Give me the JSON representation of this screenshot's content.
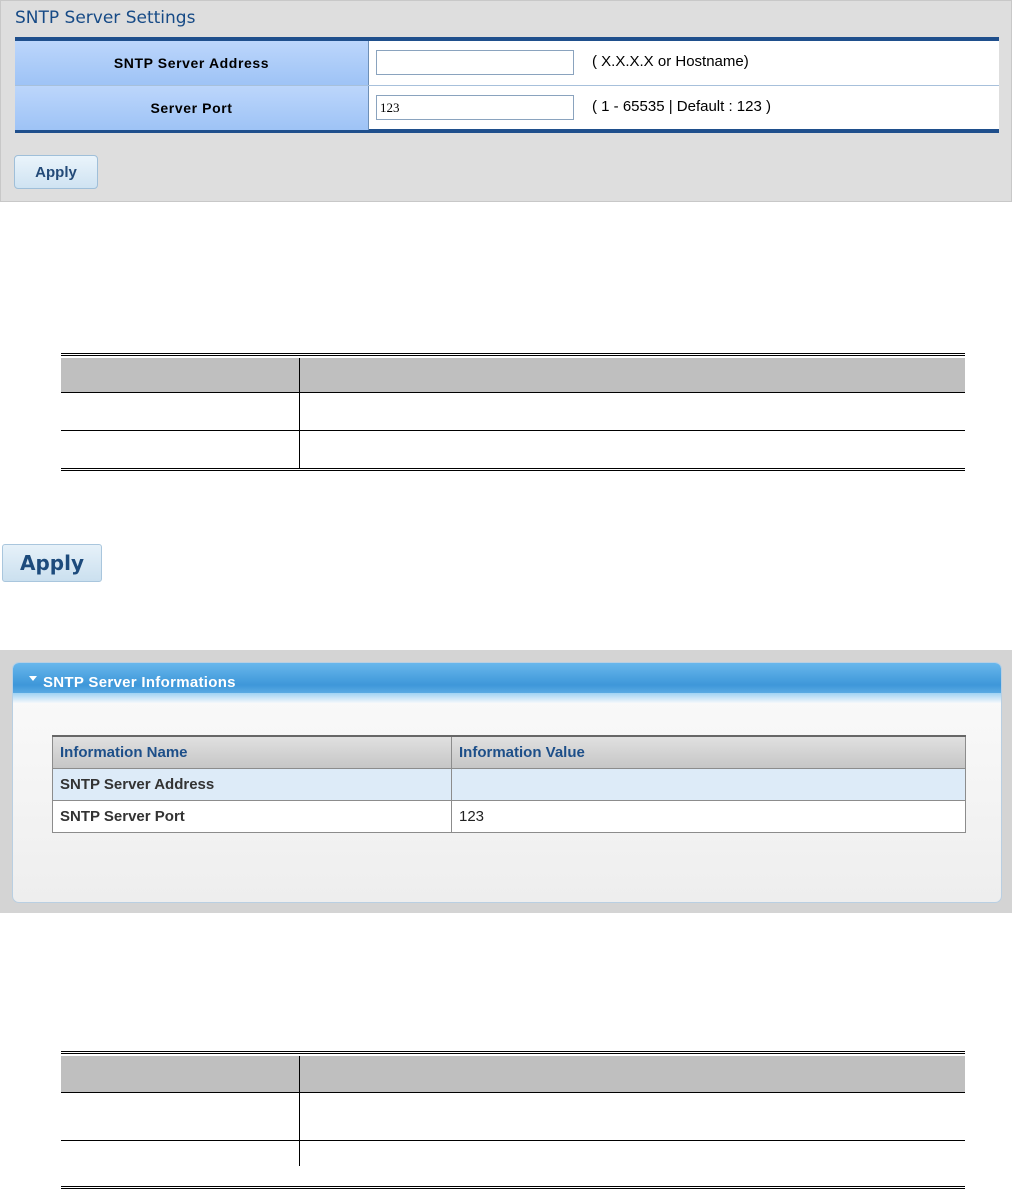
{
  "settings": {
    "title": "SNTP Server Settings",
    "rows": [
      {
        "label": "SNTP Server Address",
        "value": "",
        "hint": "( X.X.X.X or Hostname)"
      },
      {
        "label": "Server Port",
        "value": "123",
        "hint": "( 1 - 65535 | Default : 123 )"
      }
    ],
    "apply_label": "Apply"
  },
  "apply_button": {
    "label": "Apply"
  },
  "info": {
    "title": "SNTP Server Informations",
    "columns": [
      "Information Name",
      "Information Value"
    ],
    "rows": [
      {
        "name": "SNTP Server Address",
        "value": ""
      },
      {
        "name": "SNTP Server Port",
        "value": "123"
      }
    ]
  },
  "colors": {
    "panel_title": "#164a86",
    "header_accent": "#3e97d9",
    "label_cell": "#9ec3f6"
  }
}
